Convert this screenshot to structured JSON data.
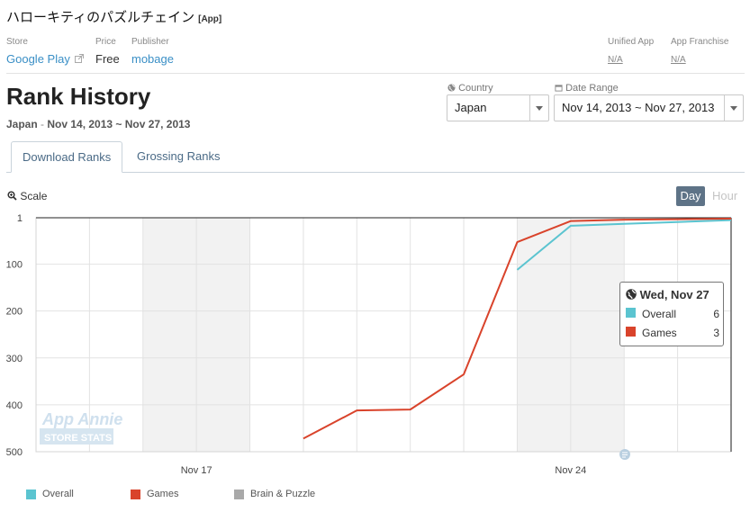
{
  "app": {
    "title": "ハローキティのパズルチェイン",
    "tag": "[App]",
    "store_label": "Store",
    "store_value": "Google Play",
    "price_label": "Price",
    "price_value": "Free",
    "publisher_label": "Publisher",
    "publisher_value": "mobage",
    "unified_label": "Unified App",
    "unified_value": "N/A",
    "franchise_label": "App Franchise",
    "franchise_value": "N/A"
  },
  "page": {
    "heading": "Rank History",
    "subtitle_country": "Japan",
    "subtitle_sep": " - ",
    "subtitle_range": "Nov 14, 2013 ~ Nov 27, 2013"
  },
  "filters": {
    "country_label": "Country",
    "country_value": "Japan",
    "date_label": "Date Range",
    "date_value": "Nov 14, 2013 ~ Nov 27, 2013"
  },
  "tabs": [
    {
      "label": "Download Ranks",
      "active": true
    },
    {
      "label": "Grossing Ranks",
      "active": false
    }
  ],
  "controls": {
    "scale_label": "Scale",
    "day_label": "Day",
    "hour_label": "Hour"
  },
  "watermark": {
    "line1": "App Annie",
    "line2": "STORE STATS"
  },
  "tooltip": {
    "date": "Wed, Nov 27",
    "rows": [
      {
        "name": "Overall",
        "value": "6",
        "color": "#5bc4d0"
      },
      {
        "name": "Games",
        "value": "3",
        "color": "#d9432b"
      }
    ]
  },
  "chart_data": {
    "type": "line",
    "x": [
      "Nov 14",
      "Nov 15",
      "Nov 16",
      "Nov 17",
      "Nov 18",
      "Nov 19",
      "Nov 20",
      "Nov 21",
      "Nov 22",
      "Nov 23",
      "Nov 24",
      "Nov 25",
      "Nov 26",
      "Nov 27"
    ],
    "x_tick_labels": [
      {
        "at": "Nov 17",
        "label": "Nov 17"
      },
      {
        "at": "Nov 24",
        "label": "Nov 24"
      }
    ],
    "y_ticks": [
      1,
      100,
      200,
      300,
      400,
      500
    ],
    "ylim": [
      1,
      500
    ],
    "y_inverted": true,
    "weekend_bands": [
      [
        "Nov 16",
        "Nov 18"
      ],
      [
        "Nov 23",
        "Nov 25"
      ]
    ],
    "grid": true,
    "legend_position": "bottom-left",
    "series": [
      {
        "name": "Overall",
        "color": "#5bc4d0",
        "values": [
          null,
          null,
          null,
          null,
          null,
          null,
          null,
          null,
          null,
          112,
          18,
          14,
          10,
          6
        ]
      },
      {
        "name": "Games",
        "color": "#d9432b",
        "values": [
          null,
          null,
          null,
          null,
          null,
          472,
          412,
          410,
          335,
          53,
          8,
          5,
          4,
          3
        ]
      },
      {
        "name": "Brain & Puzzle",
        "color": "#a9a9a9",
        "values": []
      }
    ]
  }
}
